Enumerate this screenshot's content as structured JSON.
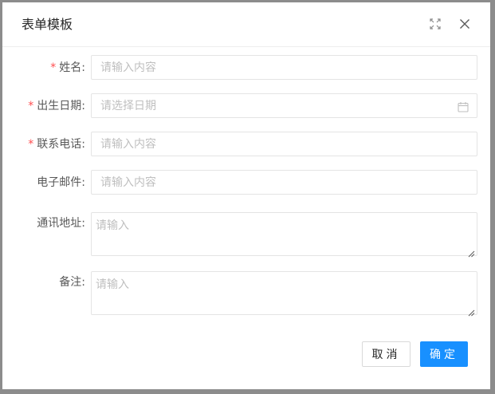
{
  "dialog": {
    "title": "表单模板",
    "maximize_icon": "maximize-icon",
    "close_icon": "close-icon"
  },
  "form": {
    "fields": [
      {
        "label": "姓名:",
        "required": true,
        "type": "text",
        "placeholder": "请输入内容",
        "value": ""
      },
      {
        "label": "出生日期:",
        "required": true,
        "type": "date",
        "placeholder": "请选择日期",
        "value": "",
        "icon": "calendar-icon"
      },
      {
        "label": "联系电话:",
        "required": true,
        "type": "text",
        "placeholder": "请输入内容",
        "value": ""
      },
      {
        "label": "电子邮件:",
        "required": false,
        "type": "text",
        "placeholder": "请输入内容",
        "value": ""
      },
      {
        "label": "通讯地址:",
        "required": false,
        "type": "textarea",
        "placeholder": "请输入",
        "value": ""
      },
      {
        "label": "备注:",
        "required": false,
        "type": "textarea",
        "placeholder": "请输入",
        "value": ""
      }
    ],
    "required_mark": "*"
  },
  "footer": {
    "cancel_label": "取消",
    "ok_label": "确定"
  },
  "colors": {
    "primary": "#1890ff",
    "required": "#ff4d4f",
    "backdrop": "#8c8c8c"
  }
}
